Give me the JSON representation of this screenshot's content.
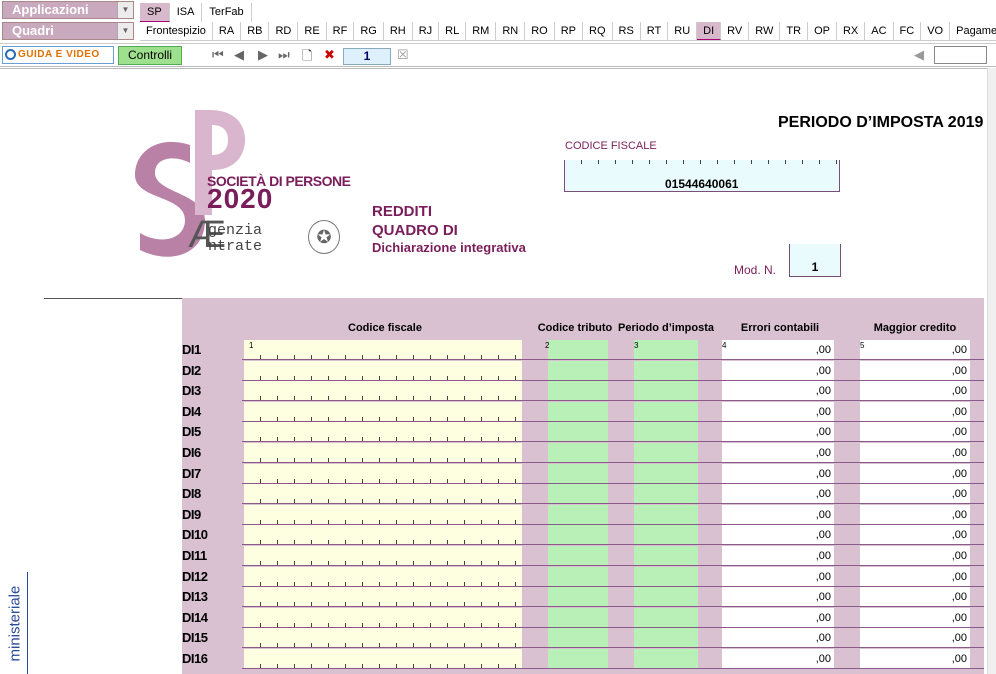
{
  "toolbar_top": {
    "applicazioni": "Applicazioni",
    "quadri": "Quadri",
    "top_tabs": [
      "SP",
      "ISA",
      "TerFab"
    ],
    "quadri_tabs": [
      "Frontespizio",
      "RA",
      "RB",
      "RD",
      "RE",
      "RF",
      "RG",
      "RH",
      "RJ",
      "RL",
      "RM",
      "RN",
      "RO",
      "RP",
      "RQ",
      "RS",
      "RT",
      "RU",
      "DI",
      "RV",
      "RW",
      "TR",
      "OP",
      "RX",
      "AC",
      "FC",
      "VO",
      "Pagamenti"
    ],
    "active_top": "SP",
    "active_quadro": "DI"
  },
  "toolbar": {
    "guida": "GUIDA E VIDEO",
    "controlli": "Controlli",
    "page": "1"
  },
  "header": {
    "periodo": "PERIODO D’IMPOSTA 2019",
    "logo_title": "SOCIETÀ DI PERSONE",
    "logo_year": "2020",
    "logo_agency_1": "genzia",
    "logo_agency_2": "ntrate",
    "redditi": "REDDITI",
    "quadro": "QUADRO DI",
    "dichiarazione": "Dichiarazione integrativa",
    "codice_fiscale_label": "CODICE FISCALE",
    "codice_fiscale_value": "01544640061",
    "mod_label": "Mod. N.",
    "mod_value": "1"
  },
  "table": {
    "headers": [
      "Codice fiscale",
      "Codice tributo",
      "Periodo d’imposta",
      "Errori contabili",
      "Maggior credito"
    ],
    "field_numbers": [
      "1",
      "2",
      "3",
      "4",
      "5"
    ],
    "rows": [
      {
        "label": "DI1",
        "errori": ",00",
        "credito": ",00"
      },
      {
        "label": "DI2",
        "errori": ",00",
        "credito": ",00"
      },
      {
        "label": "DI3",
        "errori": ",00",
        "credito": ",00"
      },
      {
        "label": "DI4",
        "errori": ",00",
        "credito": ",00"
      },
      {
        "label": "DI5",
        "errori": ",00",
        "credito": ",00"
      },
      {
        "label": "DI6",
        "errori": ",00",
        "credito": ",00"
      },
      {
        "label": "DI7",
        "errori": ",00",
        "credito": ",00"
      },
      {
        "label": "DI8",
        "errori": ",00",
        "credito": ",00"
      },
      {
        "label": "DI9",
        "errori": ",00",
        "credito": ",00"
      },
      {
        "label": "DI10",
        "errori": ",00",
        "credito": ",00"
      },
      {
        "label": "DI11",
        "errori": ",00",
        "credito": ",00"
      },
      {
        "label": "DI12",
        "errori": ",00",
        "credito": ",00"
      },
      {
        "label": "DI13",
        "errori": ",00",
        "credito": ",00"
      },
      {
        "label": "DI14",
        "errori": ",00",
        "credito": ",00"
      },
      {
        "label": "DI15",
        "errori": ",00",
        "credito": ",00"
      },
      {
        "label": "DI16",
        "errori": ",00",
        "credito": ",00"
      }
    ]
  },
  "side_label": "ministeriale",
  "colors": {
    "accent": "#8a1f5e",
    "panel": "#d9c1d2",
    "green_field": "#b8f0b8",
    "yellow_field": "#feffe0"
  }
}
